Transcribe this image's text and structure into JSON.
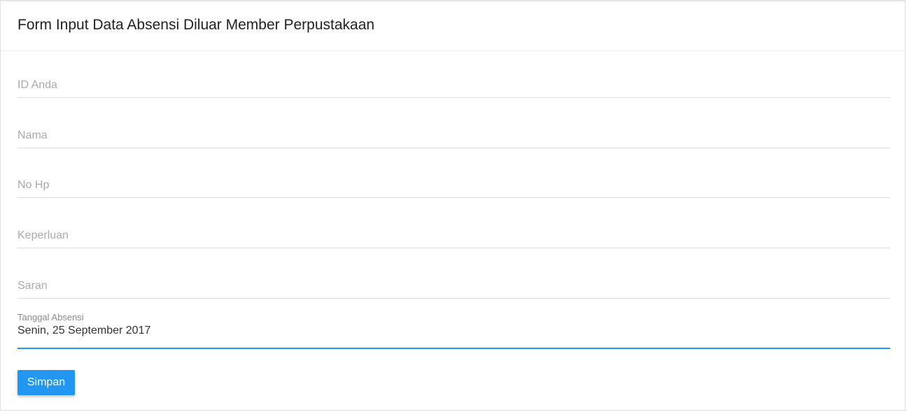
{
  "form": {
    "title": "Form Input Data Absensi Diluar Member Perpustakaan",
    "fields": [
      {
        "name": "id",
        "placeholder": "ID Anda",
        "value": ""
      },
      {
        "name": "nama",
        "placeholder": "Nama",
        "value": ""
      },
      {
        "name": "nohp",
        "placeholder": "No Hp",
        "value": ""
      },
      {
        "name": "keperluan",
        "placeholder": "Keperluan",
        "value": ""
      },
      {
        "name": "saran",
        "placeholder": "Saran",
        "value": ""
      }
    ],
    "date_field": {
      "label": "Tanggal Absensi",
      "value": "Senin, 25 September 2017"
    },
    "submit_label": "Simpan"
  },
  "colors": {
    "accent": "#2196f3",
    "placeholder": "#aaaaaa",
    "border": "#dcdcdc"
  }
}
